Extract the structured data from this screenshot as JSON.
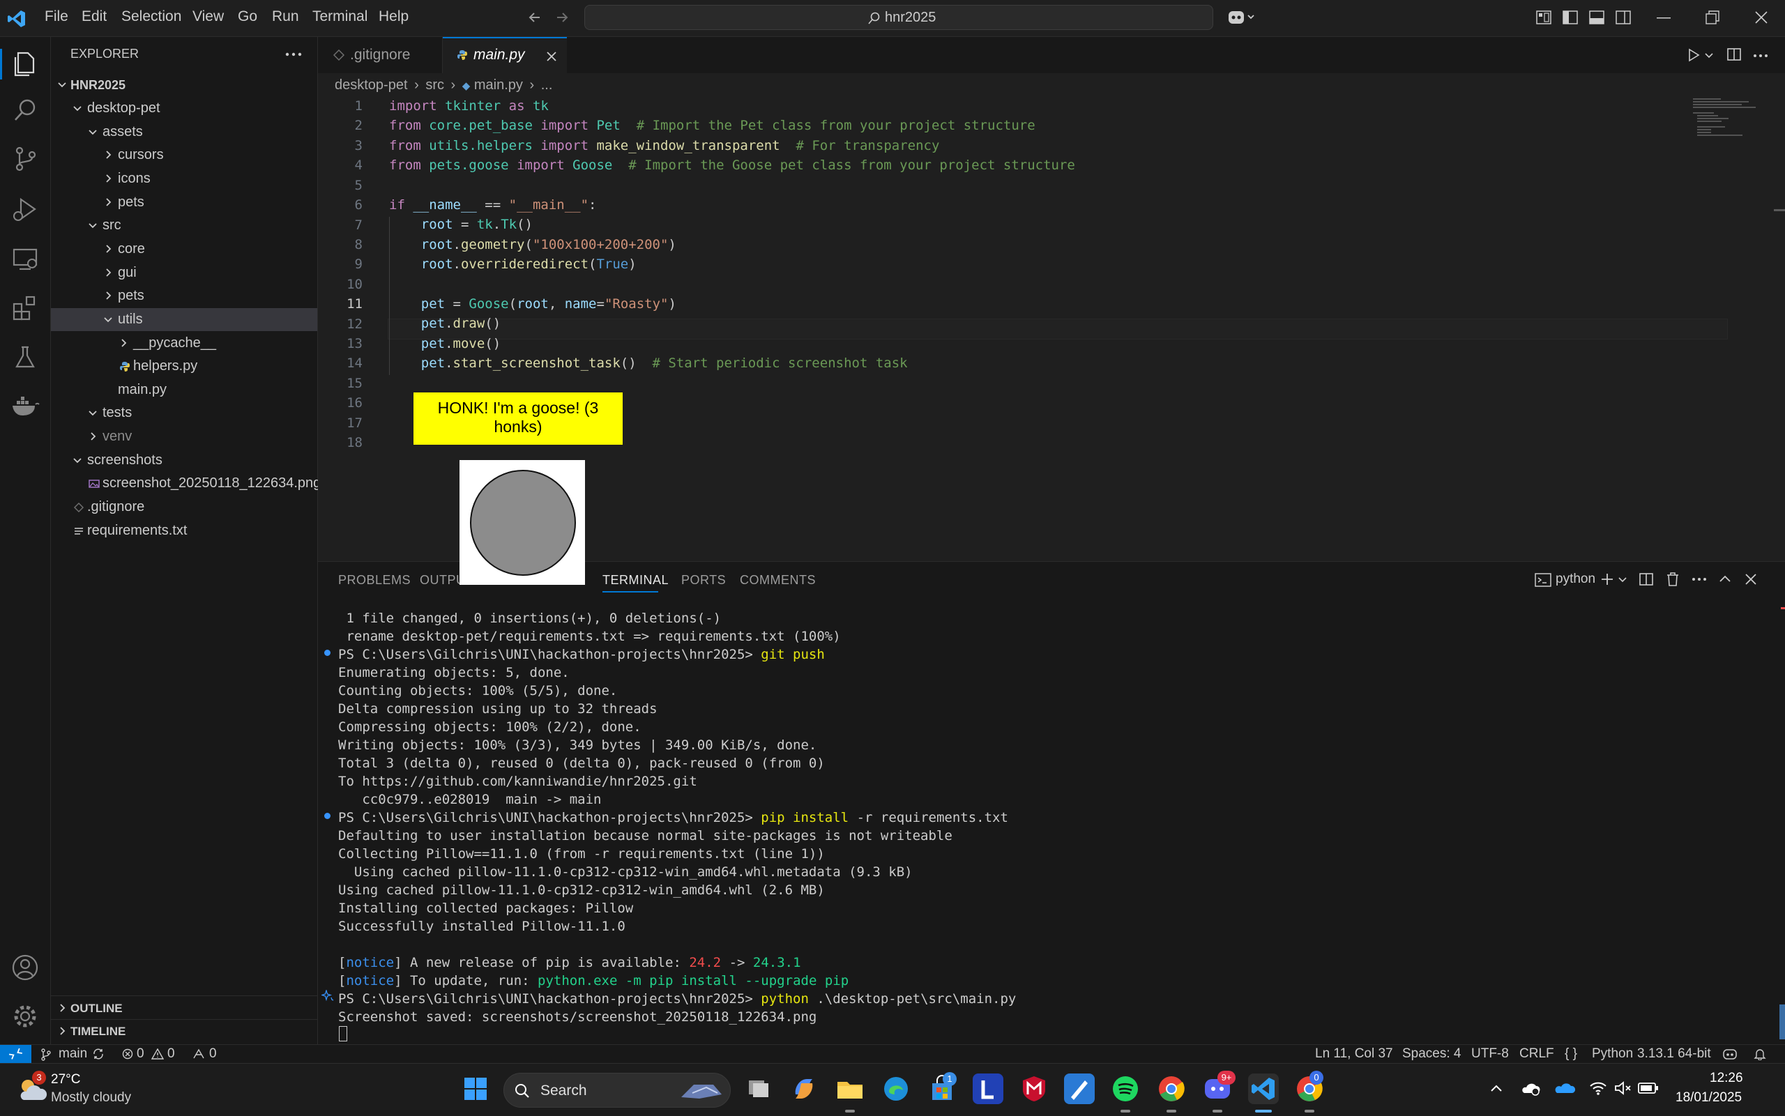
{
  "titlebar": {
    "menu": [
      "File",
      "Edit",
      "Selection",
      "View",
      "Go",
      "Run",
      "Terminal",
      "Help"
    ],
    "search_text": "hnr2025",
    "icons": [
      "vscode-logo-icon",
      "arrow-left-icon",
      "arrow-right-icon",
      "copilot-icon",
      "layout-icon",
      "minimize-icon",
      "restore-icon",
      "close-icon"
    ]
  },
  "activitybar": {
    "icons": [
      "explorer-icon",
      "search-icon",
      "source-control-icon",
      "run-debug-icon",
      "remote-explorer-icon",
      "extensions-icon",
      "testing-icon",
      "docker-icon",
      "account-icon",
      "settings-gear-icon"
    ]
  },
  "sidebar": {
    "title": "EXPLORER",
    "root": "HNR2025",
    "tree": [
      {
        "label": "desktop-pet",
        "depth": 1,
        "type": "folder-open"
      },
      {
        "label": "assets",
        "depth": 2,
        "type": "folder-open"
      },
      {
        "label": "cursors",
        "depth": 3,
        "type": "folder"
      },
      {
        "label": "icons",
        "depth": 3,
        "type": "folder"
      },
      {
        "label": "pets",
        "depth": 3,
        "type": "folder"
      },
      {
        "label": "src",
        "depth": 2,
        "type": "folder-open"
      },
      {
        "label": "core",
        "depth": 3,
        "type": "folder"
      },
      {
        "label": "gui",
        "depth": 3,
        "type": "folder"
      },
      {
        "label": "pets",
        "depth": 3,
        "type": "folder"
      },
      {
        "label": "utils",
        "depth": 3,
        "type": "folder-open",
        "selected": true
      },
      {
        "label": "__pycache__",
        "depth": 4,
        "type": "folder"
      },
      {
        "label": "helpers.py",
        "depth": 4,
        "type": "python"
      },
      {
        "label": "main.py",
        "depth": 3,
        "type": "file"
      },
      {
        "label": "tests",
        "depth": 2,
        "type": "folder-open"
      },
      {
        "label": "venv",
        "depth": 2,
        "type": "folder",
        "dim": true
      },
      {
        "label": "screenshots",
        "depth": 1,
        "type": "folder-open"
      },
      {
        "label": "screenshot_20250118_122634.png",
        "depth": 2,
        "type": "image"
      },
      {
        "label": ".gitignore",
        "depth": 1,
        "type": "gitignore"
      },
      {
        "label": "requirements.txt",
        "depth": 1,
        "type": "text"
      }
    ],
    "outline": "OUTLINE",
    "timeline": "TIMELINE"
  },
  "editor": {
    "tabs": [
      {
        "label": ".gitignore",
        "active": false
      },
      {
        "label": "main.py",
        "active": true
      }
    ],
    "breadcrumb": [
      "desktop-pet",
      "src",
      "main.py",
      "..."
    ],
    "line_numbers": [
      "1",
      "2",
      "3",
      "4",
      "5",
      "6",
      "7",
      "8",
      "9",
      "10",
      "11",
      "12",
      "13",
      "14",
      "15",
      "16",
      "17",
      "18"
    ],
    "active_line": "11"
  },
  "panel": {
    "tabs": [
      "PROBLEMS",
      "OUTPUT",
      "TERMINAL",
      "PORTS",
      "COMMENTS"
    ],
    "active_tab": "TERMINAL",
    "terminal_name": "python",
    "terminal_lines": [
      " 1 file changed, 0 insertions(+), 0 deletions(-)",
      " rename desktop-pet/requirements.txt => requirements.txt (100%)",
      "PS C:\\Users\\Gilchris\\UNI\\hackathon-projects\\hnr2025> ",
      "Enumerating objects: 5, done.",
      "Counting objects: 100% (5/5), done.",
      "Delta compression using up to 32 threads",
      "Compressing objects: 100% (2/2), done.",
      "Writing objects: 100% (3/3), 349 bytes | 349.00 KiB/s, done.",
      "Total 3 (delta 0), reused 0 (delta 0), pack-reused 0 (from 0)",
      "To https://github.com/kanniwandie/hnr2025.git",
      "   cc0c979..e028019  main -> main",
      "PS C:\\Users\\Gilchris\\UNI\\hackathon-projects\\hnr2025> ",
      "Defaulting to user installation because normal site-packages is not writeable",
      "Collecting Pillow==11.1.0 (from -r requirements.txt (line 1))",
      "  Using cached pillow-11.1.0-cp312-cp312-win_amd64.whl.metadata (9.3 kB)",
      "Using cached pillow-11.1.0-cp312-cp312-win_amd64.whl (2.6 MB)",
      "Installing collected packages: Pillow",
      "Successfully installed Pillow-11.1.0",
      "",
      "",
      "",
      "PS C:\\Users\\Gilchris\\UNI\\hackathon-projects\\hnr2025> ",
      "Screenshot saved: screenshots/screenshot_20250118_122634.png"
    ],
    "cmd_git": "git push",
    "cmd_pip": "pip install",
    "cmd_pip_args": "-r requirements.txt",
    "cmd_python": "python",
    "cmd_python_args": ".\\desktop-pet\\src\\main.py",
    "notice_1_tag": "notice",
    "notice_1_text": " A new release of pip is available: ",
    "notice_1_old": "24.2",
    "notice_1_arrow": " -> ",
    "notice_1_new": "24.3.1",
    "notice_2_tag": "notice",
    "notice_2_text": " To update, run: ",
    "notice_2_cmd": "python.exe -m pip install --upgrade pip"
  },
  "pet": {
    "speech": "HONK! I'm a goose! (3 honks)"
  },
  "statusbar": {
    "branch": "main",
    "errors": "0",
    "warnings": "0",
    "ports": "0",
    "position": "Ln 11, Col 37",
    "spaces": "Spaces: 4",
    "encoding": "UTF-8",
    "eol": "CRLF",
    "language": "Python",
    "interpreter": "3.13.1 64-bit"
  },
  "taskbar": {
    "weather_temp": "27°C",
    "weather_desc": "Mostly cloudy",
    "weather_badge": "3",
    "search_label": "Search",
    "time": "12:26",
    "date": "18/01/2025",
    "badges": {
      "store": "1",
      "discord": "9+",
      "chrome2": "0"
    }
  }
}
